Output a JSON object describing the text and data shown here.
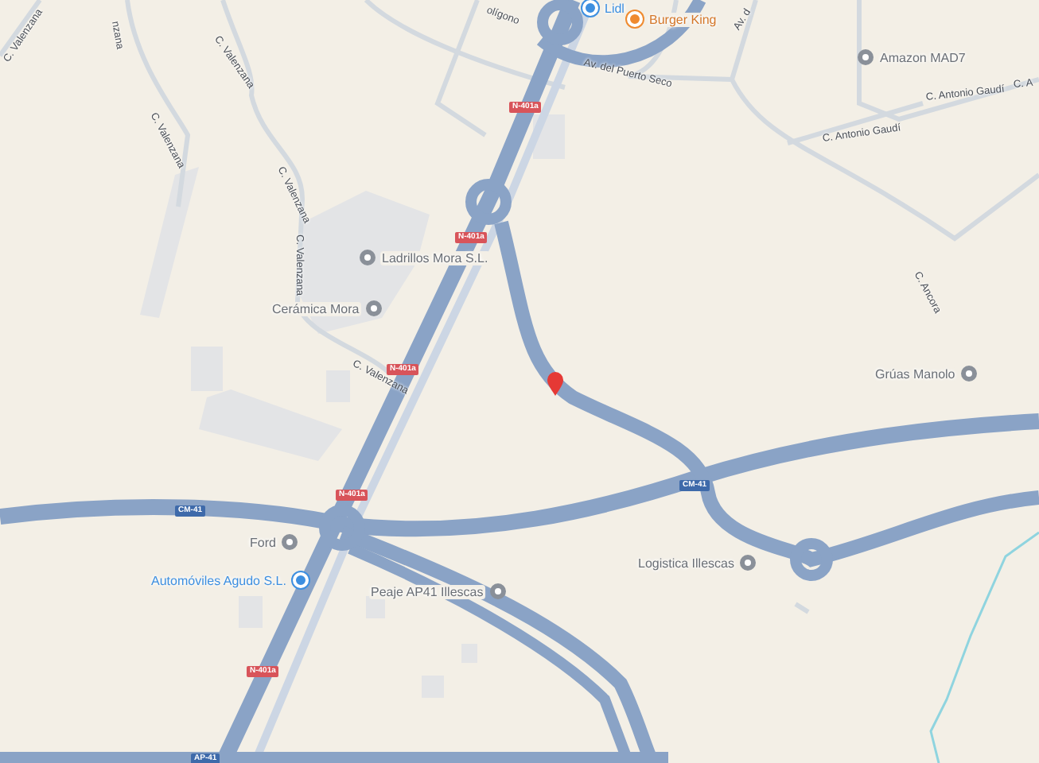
{
  "map": {
    "streets": [
      {
        "name": "C. Valenzana"
      },
      {
        "name": "nzana"
      },
      {
        "name": "C. Valenzana"
      },
      {
        "name": "C. Valenzana"
      },
      {
        "name": "C. Valenzana"
      },
      {
        "name": "C. Valenzana"
      },
      {
        "name": "C. Valenzana"
      },
      {
        "name": "olígono"
      },
      {
        "name": "Av. del Puerto Seco"
      },
      {
        "name": "Av. d"
      },
      {
        "name": "C. Antonio Gaudí"
      },
      {
        "name": "C. Antonio Gaudí"
      },
      {
        "name": "C. A"
      },
      {
        "name": "C. Ancora"
      }
    ],
    "places": [
      {
        "name": "Lidl",
        "kind": "shop"
      },
      {
        "name": "Burger King",
        "kind": "food"
      },
      {
        "name": "Amazon MAD7",
        "kind": "generic"
      },
      {
        "name": "Ladrillos Mora S.L.",
        "kind": "generic"
      },
      {
        "name": "Cerámica Mora",
        "kind": "generic"
      },
      {
        "name": "Grúas Manolo",
        "kind": "generic"
      },
      {
        "name": "Ford",
        "kind": "generic"
      },
      {
        "name": "Automóviles Agudo S.L.",
        "kind": "shop"
      },
      {
        "name": "Peaje AP41 Illescas",
        "kind": "generic"
      },
      {
        "name": "Logistica Illescas",
        "kind": "generic"
      }
    ],
    "road_shields": [
      {
        "text": "N-401a",
        "kind": "national"
      },
      {
        "text": "N-401a",
        "kind": "national"
      },
      {
        "text": "N-401a",
        "kind": "national"
      },
      {
        "text": "N-401a",
        "kind": "national"
      },
      {
        "text": "N-401a",
        "kind": "national"
      },
      {
        "text": "CM-41",
        "kind": "regional"
      },
      {
        "text": "CM-41",
        "kind": "regional"
      },
      {
        "text": "AP-41",
        "kind": "regional"
      }
    ]
  }
}
